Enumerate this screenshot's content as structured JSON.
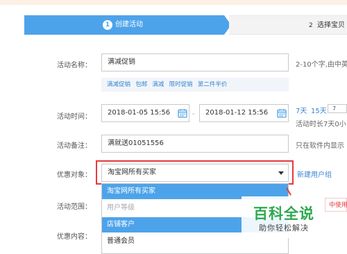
{
  "steps": [
    {
      "num": "1",
      "label": "创建活动"
    },
    {
      "num": "2",
      "label": "选择宝贝"
    }
  ],
  "form": {
    "name_label": "活动名称：",
    "name_value": "满减促销",
    "name_hint": "2-10个字,由中英",
    "tags": [
      "满减促销",
      "包邮",
      "满减",
      "限时促销",
      "第二件半价"
    ],
    "time_label": "活动时间：",
    "start_time": "2018-01-05 15:56",
    "end_time": "2018-01-12 15:56",
    "dash": "-",
    "quick_7": "7天",
    "quick_15": "15天",
    "custom_days": "7",
    "duration_hint": "活动时长7天0小",
    "remark_label": "活动备注：",
    "remark_value": "满就送01051556",
    "remark_hint": "只在软件内显示",
    "target_label": "优惠对象：",
    "target_value": "淘宝网所有买家",
    "new_group_link": "新建用户组",
    "scope_label": "活动范围：",
    "content_label": "优惠内容：",
    "scope_hint": "中使用"
  },
  "dropdown": {
    "options": [
      {
        "label": "淘宝网所有买家",
        "state": "selected"
      },
      {
        "label": "用户等级",
        "state": "disabled"
      },
      {
        "label": "店铺客户",
        "state": "hover"
      },
      {
        "label": "普通会员",
        "state": "normal"
      }
    ]
  },
  "watermark": {
    "main": "百科全说",
    "sub": "助你轻松解决"
  },
  "colors": {
    "accent": "#4da3ea",
    "link": "#3c86cf",
    "highlight_red": "#e53a3a",
    "watermark_green": "#2da94f"
  }
}
